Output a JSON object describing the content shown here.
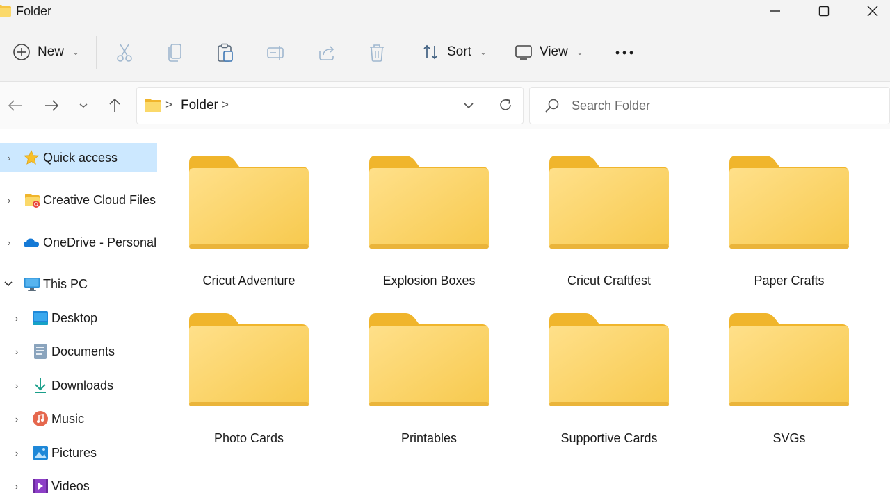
{
  "window": {
    "title": "Folder",
    "controls": [
      "minimize",
      "maximize",
      "close"
    ]
  },
  "toolbar": {
    "new_label": "New",
    "sort_label": "Sort",
    "view_label": "View",
    "icons": [
      "cut-icon",
      "copy-icon",
      "paste-icon",
      "rename-icon",
      "share-icon",
      "delete-icon",
      "more-icon"
    ]
  },
  "address": {
    "path": [
      "Folder"
    ],
    "refresh_icon": "refresh-icon"
  },
  "search": {
    "placeholder": "Search Folder"
  },
  "sidebar": {
    "items": [
      {
        "label": "Quick access",
        "icon": "star-icon",
        "expanded": false,
        "selected": true
      },
      {
        "label": "Creative Cloud Files",
        "icon": "creative-cloud-folder-icon",
        "expanded": false
      },
      {
        "label": "OneDrive - Personal",
        "icon": "cloud-icon",
        "expanded": false
      },
      {
        "label": "This PC",
        "icon": "pc-icon",
        "expanded": true
      },
      {
        "label": "Desktop",
        "icon": "desktop-icon",
        "expanded": false
      },
      {
        "label": "Documents",
        "icon": "documents-icon",
        "expanded": false
      },
      {
        "label": "Downloads",
        "icon": "download-icon",
        "expanded": false
      },
      {
        "label": "Music",
        "icon": "music-icon",
        "expanded": false
      },
      {
        "label": "Pictures",
        "icon": "pictures-icon",
        "expanded": false
      },
      {
        "label": "Videos",
        "icon": "videos-icon",
        "expanded": false
      }
    ]
  },
  "folders": [
    {
      "name": "Cricut Adventure"
    },
    {
      "name": "Explosion Boxes"
    },
    {
      "name": "Cricut Craftfest"
    },
    {
      "name": "Paper Crafts"
    },
    {
      "name": "Photo Cards"
    },
    {
      "name": "Printables"
    },
    {
      "name": "Supportive Cards"
    },
    {
      "name": "SVGs"
    }
  ],
  "colors": {
    "folder_body": "#f9d56a",
    "folder_tab": "#f0b52c",
    "selection": "#cce8ff",
    "accent": "#0067c0"
  }
}
